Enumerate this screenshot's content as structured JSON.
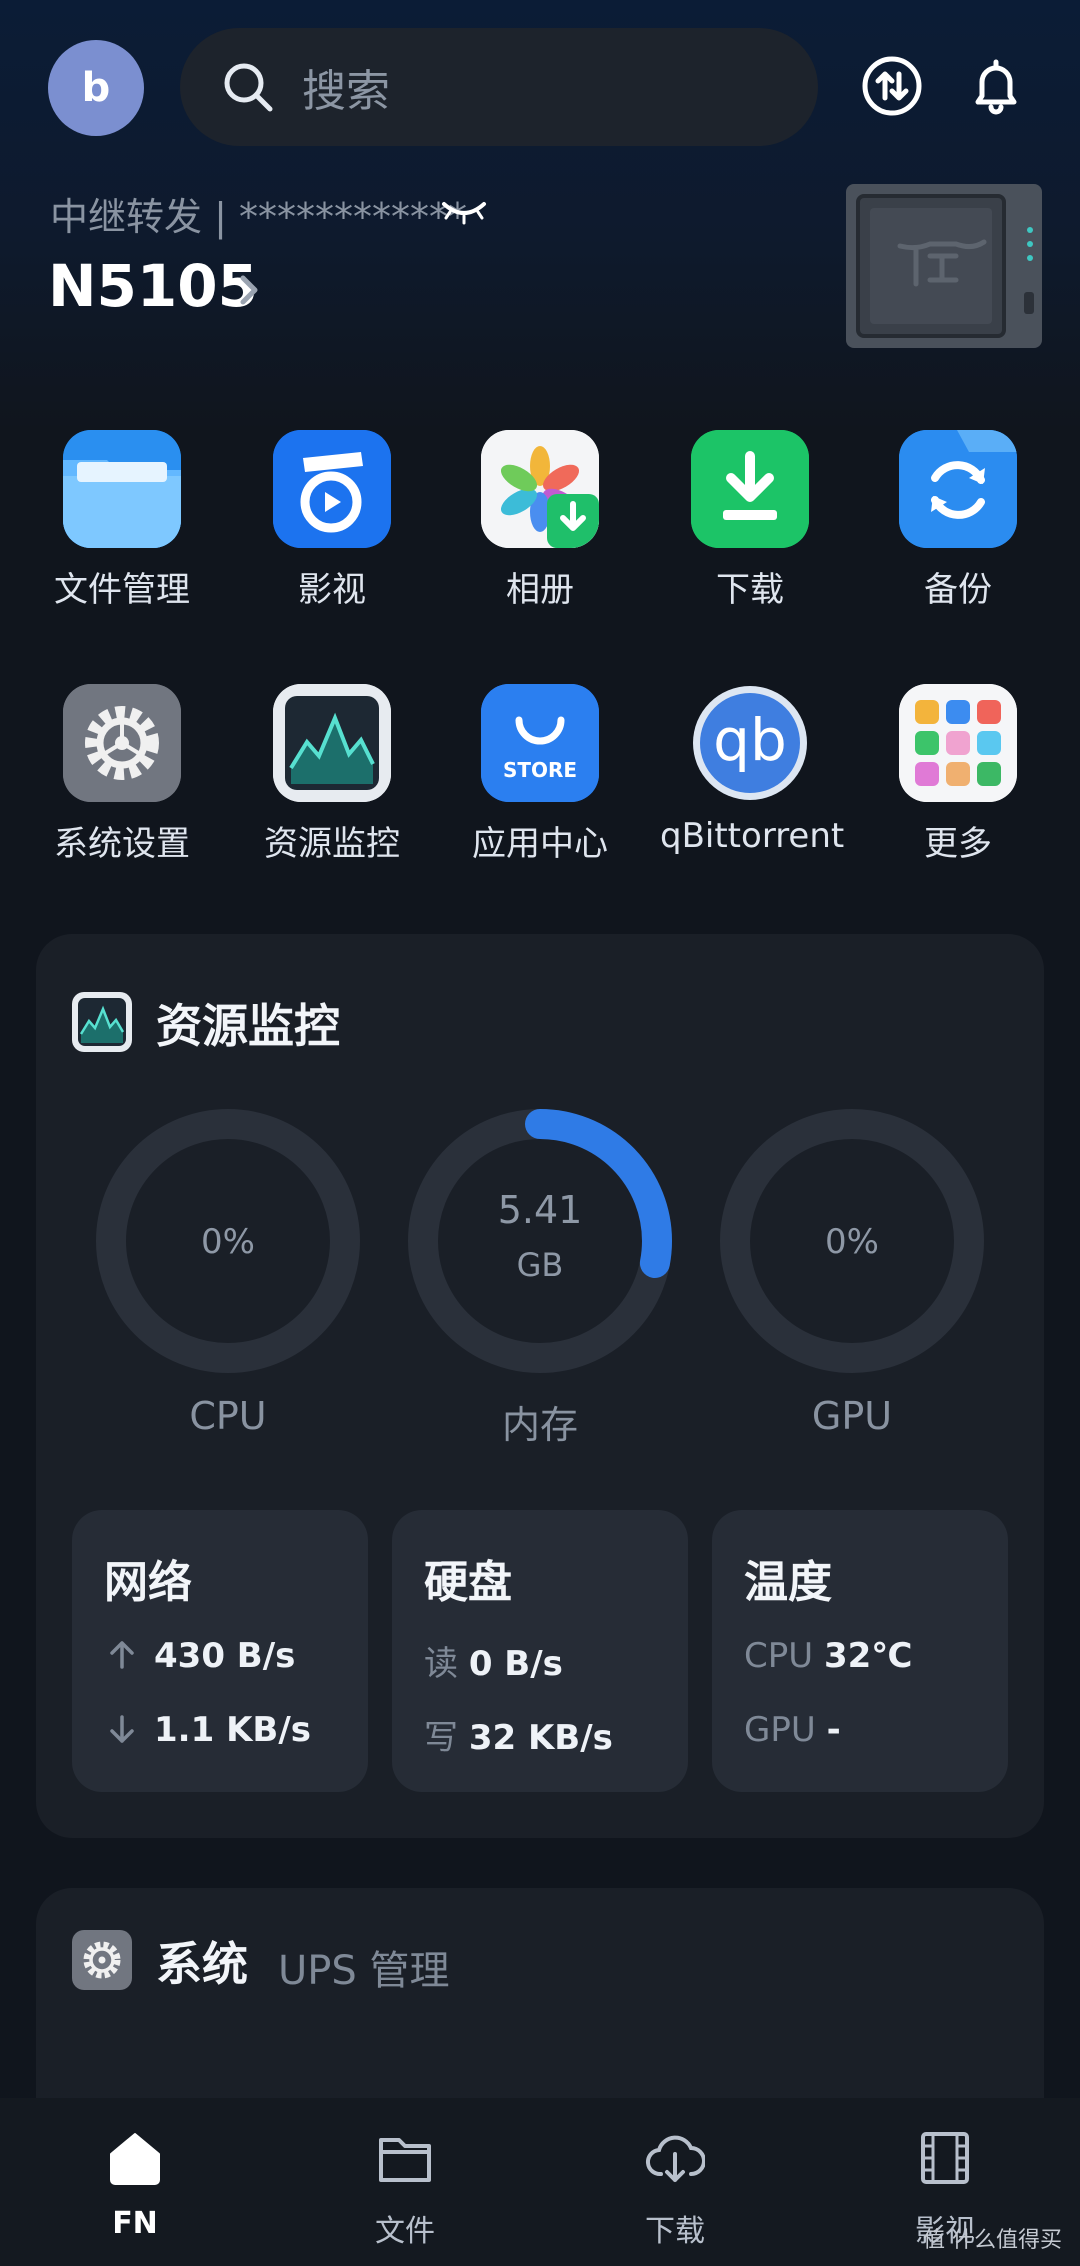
{
  "header": {
    "avatar_letter": "b",
    "search_placeholder": "搜索",
    "relay_text": "中继转发 | ************",
    "device_name": "N5105"
  },
  "apps_row1": [
    {
      "label": "文件管理",
      "icon": "folder-icon"
    },
    {
      "label": "影视",
      "icon": "video-icon"
    },
    {
      "label": "相册",
      "icon": "photos-icon"
    },
    {
      "label": "下载",
      "icon": "download-icon"
    },
    {
      "label": "备份",
      "icon": "backup-icon"
    }
  ],
  "apps_row2": [
    {
      "label": "系统设置",
      "icon": "gear-icon"
    },
    {
      "label": "资源监控",
      "icon": "monitor-icon"
    },
    {
      "label": "应用中心",
      "icon": "store-icon"
    },
    {
      "label": "qBittorrent",
      "icon": "qbittorrent-icon"
    },
    {
      "label": "更多",
      "icon": "more-apps-icon"
    }
  ],
  "store_badge": "STORE",
  "qb_badge": "qb",
  "monitor": {
    "title": "资源监控",
    "cpu": {
      "value": "0%",
      "label": "CPU",
      "fraction": 0
    },
    "memory": {
      "value": "5.41",
      "unit": "GB",
      "label": "内存",
      "fraction": 0.28
    },
    "gpu": {
      "value": "0%",
      "label": "GPU",
      "fraction": 0
    },
    "network": {
      "title": "网络",
      "up": "430 B/s",
      "down": "1.1 KB/s"
    },
    "disk": {
      "title": "硬盘",
      "read_key": "读",
      "read": "0 B/s",
      "write_key": "写",
      "write": "32 KB/s"
    },
    "temp": {
      "title": "温度",
      "cpu_key": "CPU",
      "cpu": "32℃",
      "gpu_key": "GPU",
      "gpu": "-"
    },
    "accent": "#2f7be6"
  },
  "system": {
    "title": "系统",
    "subtitle": "UPS 管理"
  },
  "nav": [
    {
      "label": "FN",
      "active": true
    },
    {
      "label": "文件",
      "active": false
    },
    {
      "label": "下载",
      "active": false
    },
    {
      "label": "影视",
      "active": false
    }
  ],
  "watermark": "值 什么值得买"
}
